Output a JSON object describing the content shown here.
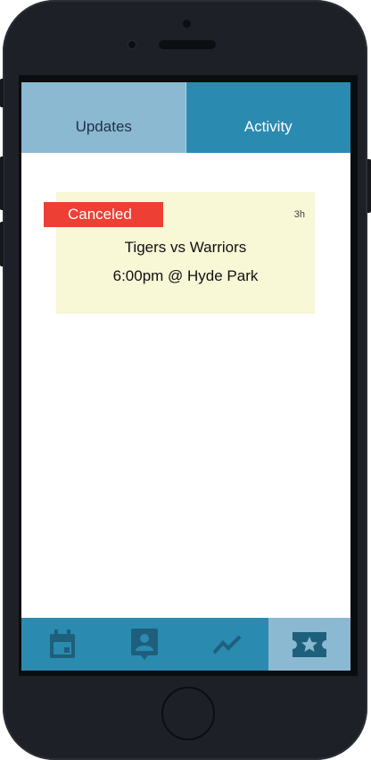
{
  "tabs": [
    {
      "label": "Updates",
      "active": false
    },
    {
      "label": "Activity",
      "active": true
    }
  ],
  "card": {
    "status": "Canceled",
    "age": "3h",
    "title": "Tigers vs Warriors",
    "details": "6:00pm @ Hyde Park"
  },
  "bottom_nav": [
    {
      "icon": "calendar-icon",
      "active": false
    },
    {
      "icon": "contact-badge-icon",
      "active": false
    },
    {
      "icon": "trending-icon",
      "active": false
    },
    {
      "icon": "ticket-star-icon",
      "active": true
    }
  ],
  "colors": {
    "accent": "#2b8ab0",
    "accent_light": "#8ab9d1",
    "status_canceled": "#ee3f34",
    "card_bg": "#f8f7d6"
  }
}
